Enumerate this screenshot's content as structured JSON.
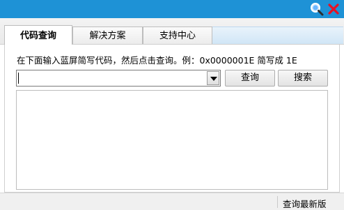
{
  "titlebar": {
    "search_icon": "search-icon",
    "close_icon": "close-icon",
    "colors": {
      "bar": "#1e92d6",
      "close": "#e81123"
    }
  },
  "tabs": [
    {
      "label": "代码查询",
      "active": true
    },
    {
      "label": "解决方案",
      "active": false
    },
    {
      "label": "支持中心",
      "active": false
    }
  ],
  "query": {
    "hint": "在下面输入蓝屏简写代码，然后点击查询。例：0x0000001E 简写成 1E",
    "input_value": "",
    "query_button": "查询",
    "search_button": "搜索"
  },
  "results": {
    "text": ""
  },
  "status": {
    "link": "查询最新版"
  }
}
